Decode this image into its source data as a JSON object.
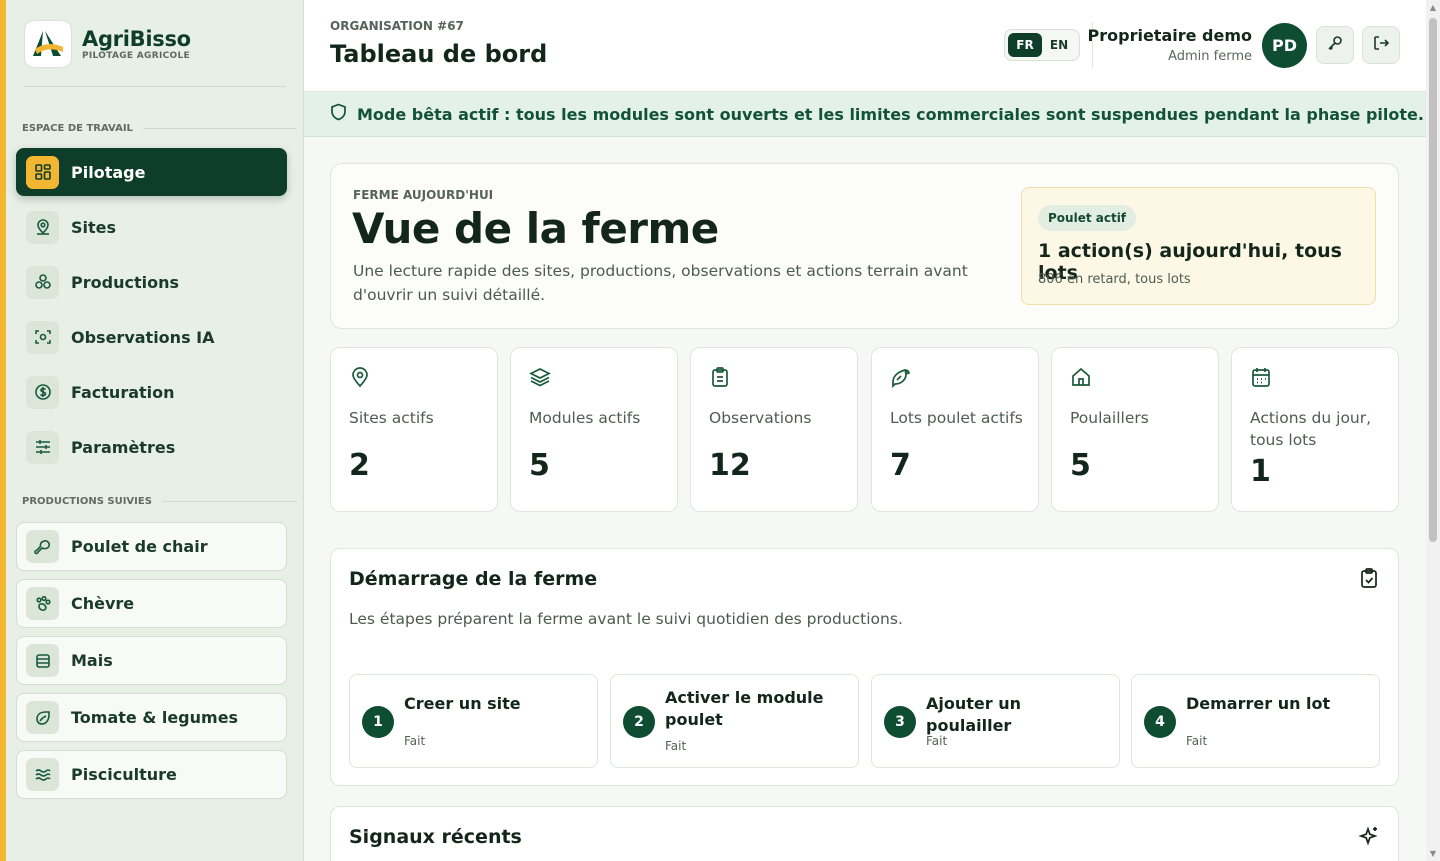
{
  "brand": {
    "name": "AgriBisso",
    "tagline": "PILOTAGE AGRICOLE"
  },
  "sidebar": {
    "workspace_label": "ESPACE DE TRAVAIL",
    "nav": [
      {
        "label": "Pilotage",
        "icon": "dashboard-icon",
        "active": true
      },
      {
        "label": "Sites",
        "icon": "map-pin-icon"
      },
      {
        "label": "Productions",
        "icon": "productions-icon"
      },
      {
        "label": "Observations IA",
        "icon": "scan-icon"
      },
      {
        "label": "Facturation",
        "icon": "dollar-icon"
      },
      {
        "label": "Paramètres",
        "icon": "sliders-icon"
      }
    ],
    "productions_label": "PRODUCTIONS SUIVIES",
    "productions": [
      {
        "label": "Poulet de chair",
        "icon": "drumstick-icon"
      },
      {
        "label": "Chèvre",
        "icon": "paw-icon"
      },
      {
        "label": "Mais",
        "icon": "grain-icon"
      },
      {
        "label": "Tomate & legumes",
        "icon": "leaf-icon"
      },
      {
        "label": "Pisciculture",
        "icon": "waves-icon"
      }
    ]
  },
  "header": {
    "org_label": "ORGANISATION #67",
    "title": "Tableau de bord",
    "lang_fr": "FR",
    "lang_en": "EN",
    "lang_active": "FR",
    "user_name": "Proprietaire demo",
    "user_role": "Admin ferme",
    "avatar_initials": "PD"
  },
  "banner": {
    "text": "Mode bêta actif : tous les modules sont ouverts et les limites commerciales sont suspendues pendant la phase pilote."
  },
  "hero": {
    "kicker": "FERME AUJOURD'HUI",
    "title": "Vue de la ferme",
    "description": "Une lecture rapide des sites, productions, observations et actions terrain avant d'ouvrir un suivi détaillé.",
    "card": {
      "pill": "Poulet actif",
      "main": "1 action(s) aujourd'hui, tous lots",
      "sub": "806 en retard, tous lots"
    }
  },
  "stats": [
    {
      "label": "Sites actifs",
      "value": "2",
      "icon": "map-pin-icon"
    },
    {
      "label": "Modules actifs",
      "value": "5",
      "icon": "layers-icon"
    },
    {
      "label": "Observations",
      "value": "12",
      "icon": "clipboard-icon"
    },
    {
      "label": "Lots poulet actifs",
      "value": "7",
      "icon": "bird-icon"
    },
    {
      "label": "Poulaillers",
      "value": "5",
      "icon": "home-icon"
    },
    {
      "label": "Actions du jour, tous lots",
      "value": "1",
      "icon": "calendar-icon"
    }
  ],
  "startup": {
    "title": "Démarrage de la ferme",
    "description": "Les étapes préparent la ferme avant le suivi quotidien des productions.",
    "steps": [
      {
        "num": "1",
        "name": "Creer un site",
        "state": "Fait"
      },
      {
        "num": "2",
        "name": "Activer le module poulet",
        "state": "Fait"
      },
      {
        "num": "3",
        "name": "Ajouter un poulailler",
        "state": "Fait"
      },
      {
        "num": "4",
        "name": "Demarrer un lot",
        "state": "Fait"
      }
    ]
  },
  "signals": {
    "title": "Signaux récents"
  },
  "colors": {
    "primary": "#0f3d2b",
    "accent": "#f2b632",
    "banner_bg": "#e4f1e8",
    "hero_card_bg": "#fdf8e6"
  }
}
